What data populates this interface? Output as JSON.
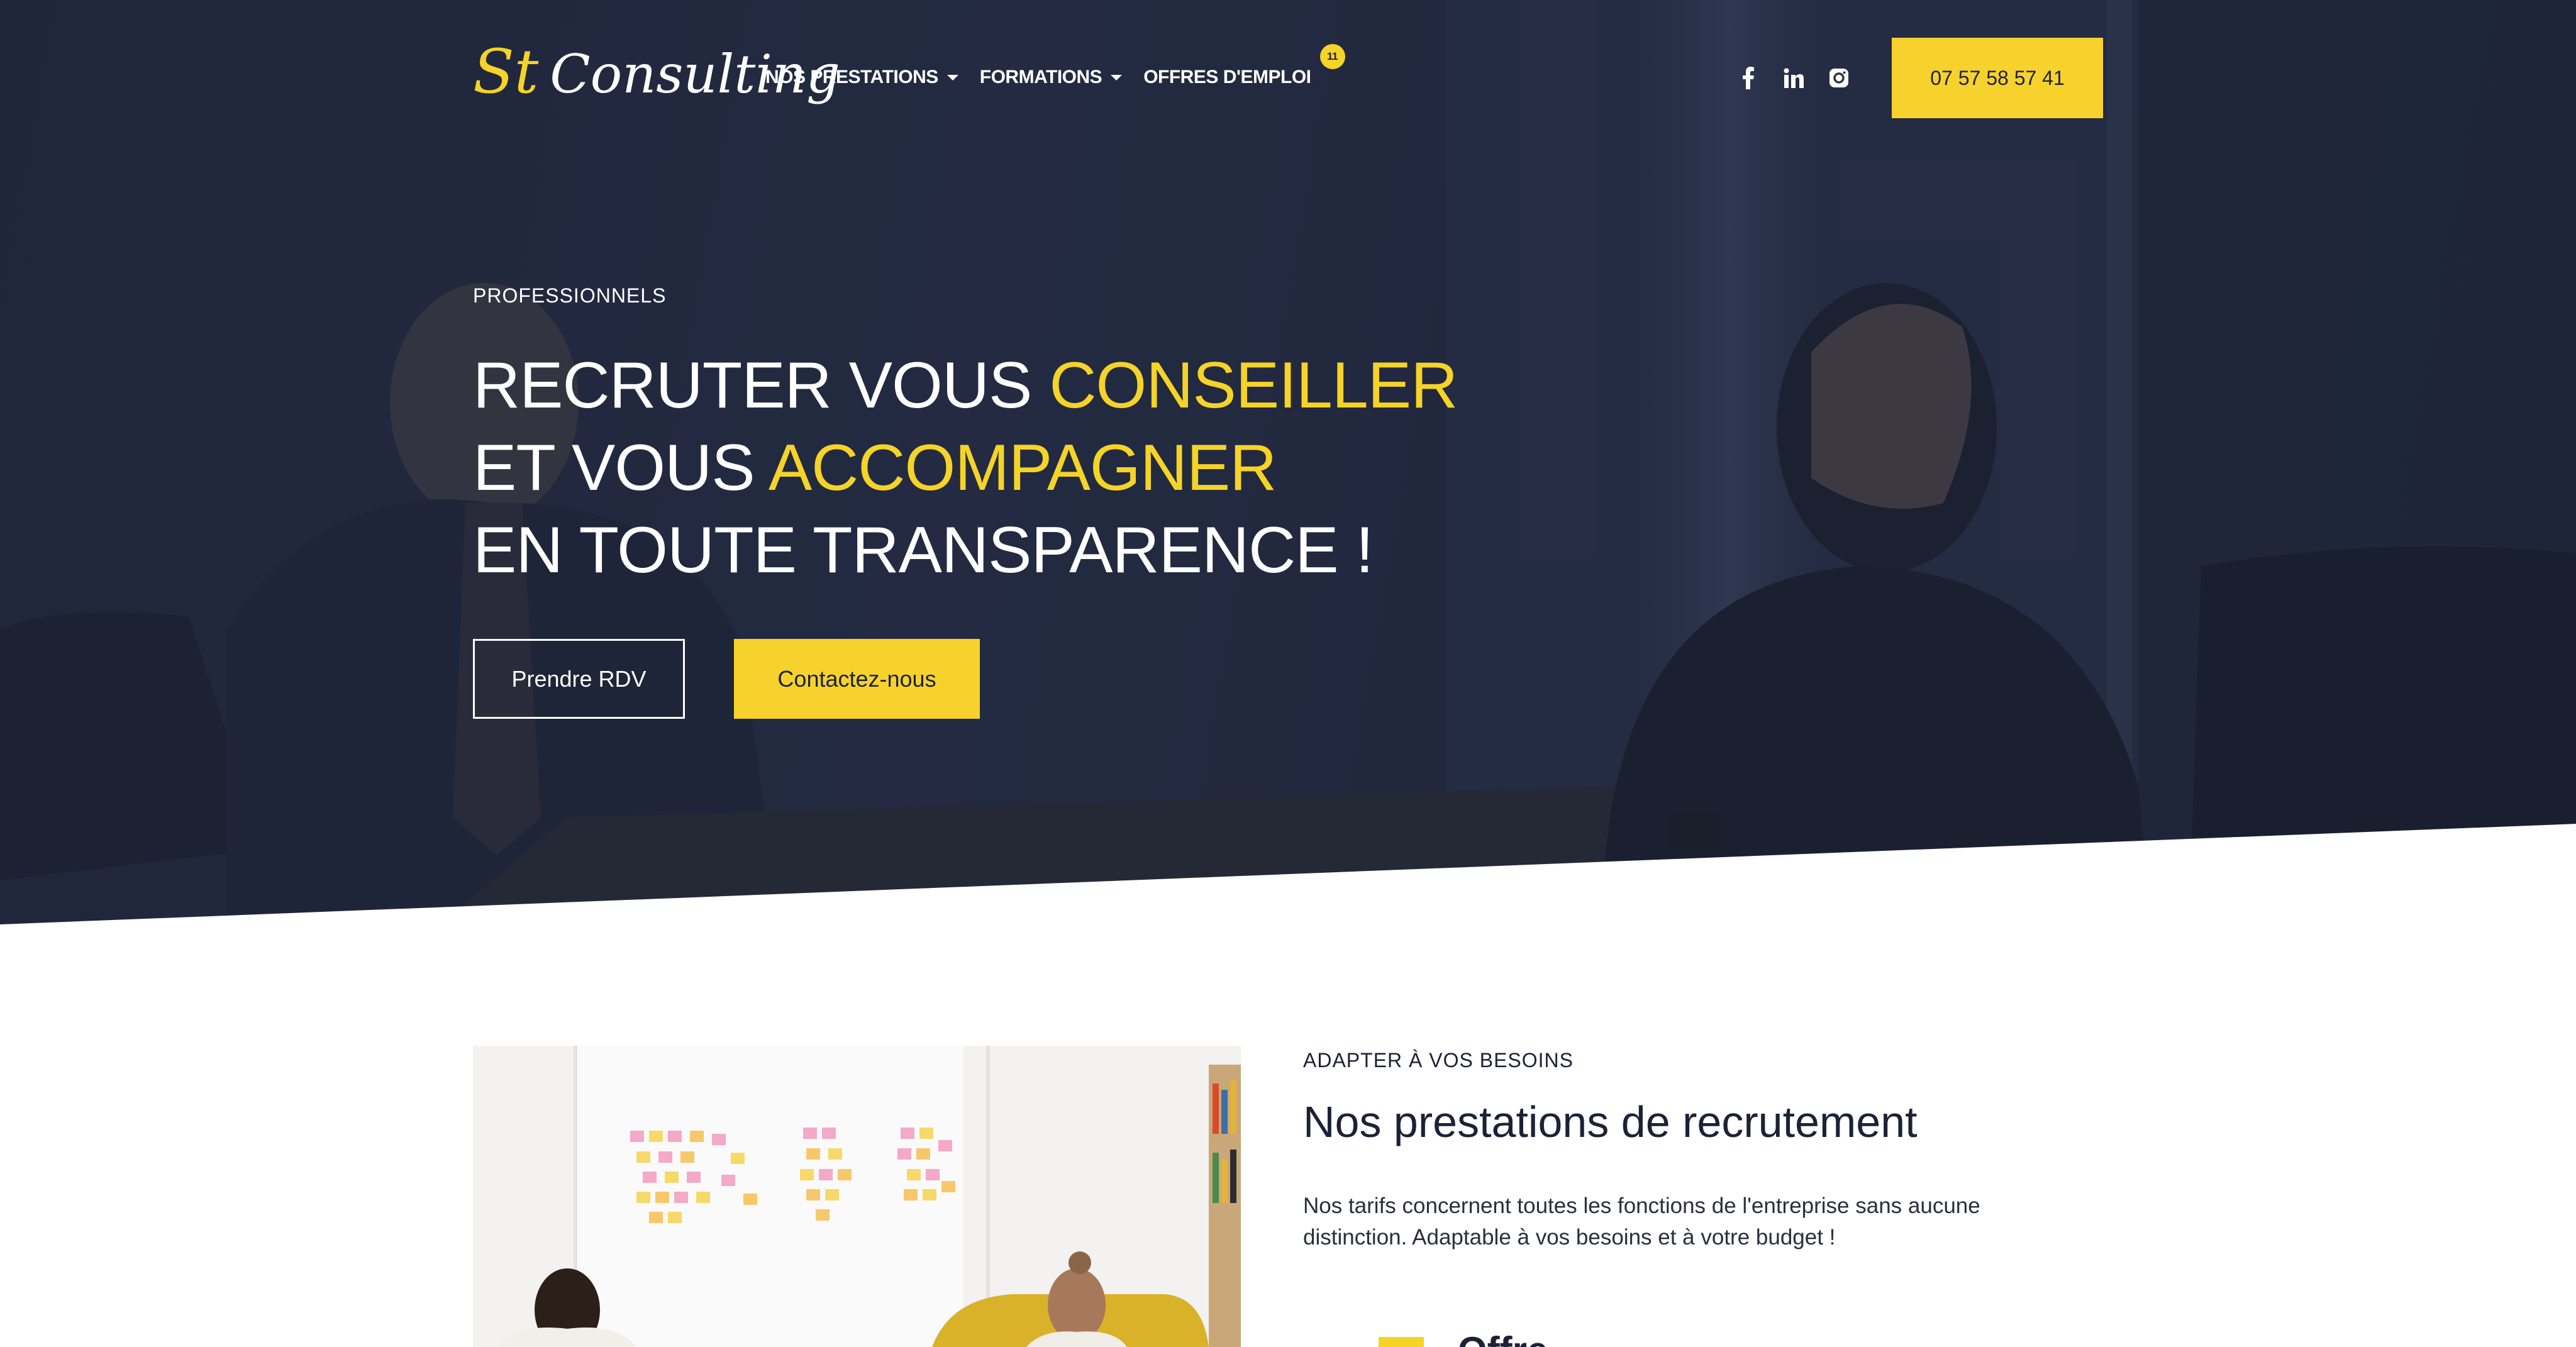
{
  "brand": {
    "logo_part1": "St",
    "logo_part2": "Consulting",
    "accent_color": "#f5d327",
    "dark_color": "#1c2236"
  },
  "nav": {
    "items": [
      {
        "label": "NOS PRESTATIONS",
        "has_dropdown": true
      },
      {
        "label": "FORMATIONS",
        "has_dropdown": true
      },
      {
        "label": "OFFRES D'EMPLOI",
        "badge": "11"
      }
    ],
    "socials": [
      "facebook-icon",
      "linkedin-icon",
      "instagram-icon"
    ],
    "phone": "07 57 58 57 41"
  },
  "hero": {
    "eyebrow": "PROFESSIONNELS",
    "line1_white": "RECRUTER VOUS ",
    "line1_yellow": "CONSEILLER",
    "line2_white": "ET VOUS ",
    "line2_yellow": "ACCOMPAGNER",
    "line3": "EN TOUTE TRANSPARENCE !",
    "btn_rdv": "Prendre RDV",
    "btn_contact": "Contactez-nous"
  },
  "section": {
    "eyebrow": "ADAPTER À VOS BESOINS",
    "title": "Nos prestations de recrutement",
    "text": "Nos tarifs concernent toutes les fonctions de l'entreprise sans aucune distinction. Adaptable à vos besoins et à votre budget !",
    "peek_title": "Offre basique"
  }
}
